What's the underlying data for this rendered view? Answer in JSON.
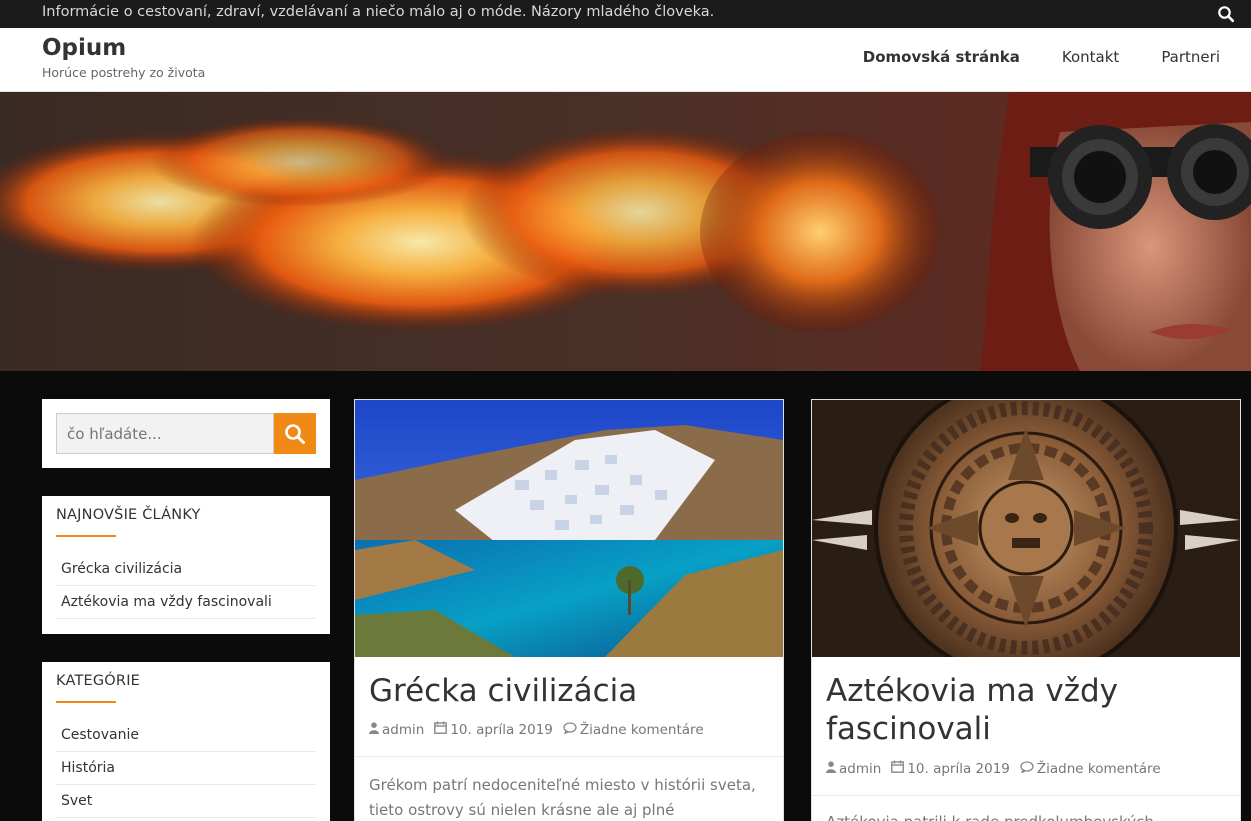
{
  "topbar": {
    "tagline": "Informácie o cestovaní, zdraví, vzdelávaní a niečo málo aj o móde. Názory mladého človeka.",
    "search_icon": "search-icon"
  },
  "site": {
    "title": "Opium",
    "subtitle": "Horúce postrehy zo života"
  },
  "nav": {
    "items": [
      {
        "label": "Domovská stránka"
      },
      {
        "label": "Kontakt"
      },
      {
        "label": "Partneri"
      }
    ]
  },
  "sidebar": {
    "search": {
      "placeholder": "čo hľadáte..."
    },
    "recent": {
      "title": "NAJNOVŠIE ČLÁNKY",
      "items": [
        {
          "label": "Grécka civilizácia"
        },
        {
          "label": "Aztékovia ma vždy fascinovali"
        }
      ]
    },
    "categories": {
      "title": "KATEGÓRIE",
      "items": [
        {
          "label": "Cestovanie"
        },
        {
          "label": "História"
        },
        {
          "label": "Svet"
        }
      ]
    }
  },
  "posts": [
    {
      "title": "Grécka civilizácia",
      "author": "admin",
      "date": "10. apríla 2019",
      "comments": "Žiadne komentáre",
      "excerpt_1": "Grékom patrí nedoceniteľné miesto v histórii sveta,",
      "excerpt_2": "tieto ostrovy sú nielen krásne ale aj plné zaujímavostí"
    },
    {
      "title_1": "Aztékovia ma vždy",
      "title_2": "fascinovali",
      "author": "admin",
      "date": "10. apríla 2019",
      "comments": "Žiadne komentáre",
      "excerpt_1": "Aztékovia patrili k rade predkolumbovských civilizácií"
    }
  ],
  "colors": {
    "accent": "#ef8a17",
    "topbar": "#1b1b1b",
    "background": "#0b0b0b"
  }
}
